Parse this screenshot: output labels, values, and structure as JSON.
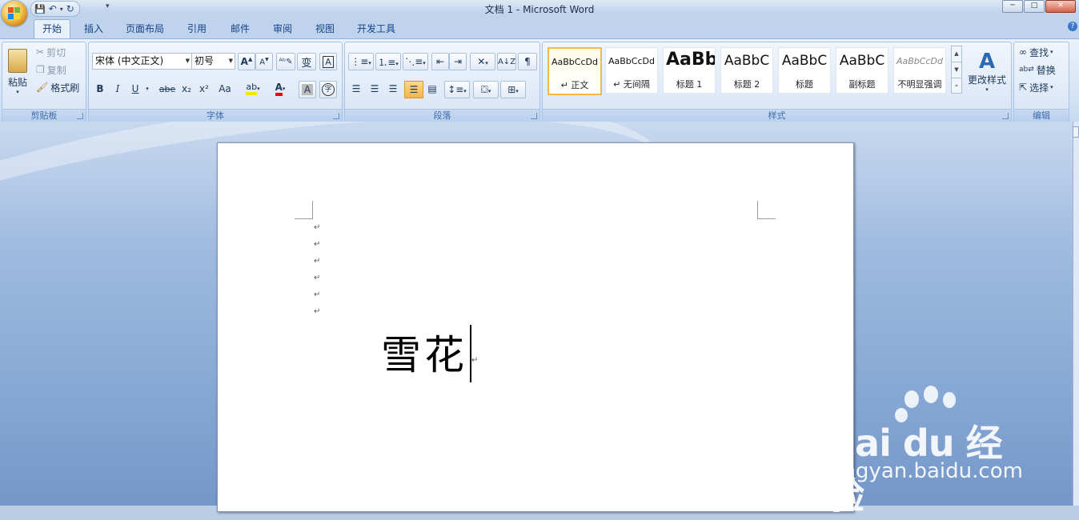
{
  "window": {
    "title": "文档 1 - Microsoft Word",
    "controls": [
      "─",
      "□",
      "✕"
    ]
  },
  "qat": {
    "save": "💾",
    "undo": "↶",
    "redo": "↻"
  },
  "tabs": [
    "开始",
    "插入",
    "页面布局",
    "引用",
    "邮件",
    "审阅",
    "视图",
    "开发工具"
  ],
  "clipboard": {
    "paste": "粘贴",
    "cut": "剪切",
    "copy": "复制",
    "format_painter": "格式刷",
    "label": "剪贴板"
  },
  "font": {
    "name": "宋体 (中文正文)",
    "size": "初号",
    "label": "字体",
    "buttons": [
      "B",
      "I",
      "U",
      "abe",
      "x₂",
      "x²",
      "Aa"
    ]
  },
  "paragraph": {
    "label": "段落"
  },
  "styles": {
    "label": "样式",
    "items": [
      {
        "preview": "AaBbCcDd",
        "name": "↵ 正文"
      },
      {
        "preview": "AaBbCcDd",
        "name": "↵ 无间隔"
      },
      {
        "preview": "AaBb",
        "name": "标题 1"
      },
      {
        "preview": "AaBbC",
        "name": "标题 2"
      },
      {
        "preview": "AaBbC",
        "name": "标题"
      },
      {
        "preview": "AaBbC",
        "name": "副标题"
      },
      {
        "preview": "AaBbCcDd",
        "name": "不明显强调"
      }
    ],
    "change_styles": "更改样式"
  },
  "editing": {
    "find": "查找",
    "replace": "替换",
    "select": "选择",
    "label": "编辑"
  },
  "document": {
    "paragraph_marks": [
      "↵",
      "↵",
      "↵",
      "↵",
      "↵",
      "↵"
    ],
    "text": "雪花",
    "after_mark": "↵"
  },
  "watermark": {
    "brand": "Bai du 经验",
    "url": "jingyan.baidu.com"
  }
}
